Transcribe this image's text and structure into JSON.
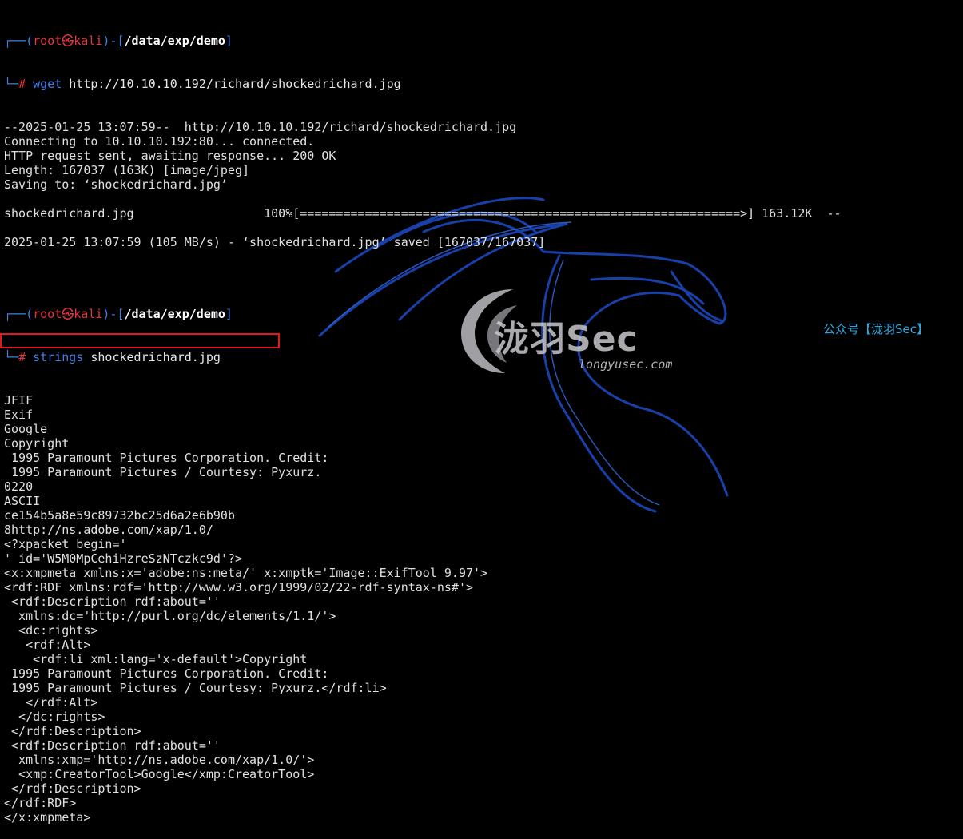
{
  "prompt1": {
    "open": "┌──(",
    "user": "root",
    "at": "㉿",
    "host": "kali",
    "mid": ")-[",
    "path": "/data/exp/demo",
    "close": "]",
    "corner": "└─",
    "hash": "#",
    "command": "wget",
    "args": "http://10.10.10.192/richard/shockedrichard.jpg"
  },
  "wget_output": [
    "--2025-01-25 13:07:59--  http://10.10.10.192/richard/shockedrichard.jpg",
    "Connecting to 10.10.10.192:80... connected.",
    "HTTP request sent, awaiting response... 200 OK",
    "Length: 167037 (163K) [image/jpeg]",
    "Saving to: ‘shockedrichard.jpg’",
    "",
    "shockedrichard.jpg                  100%[=============================================================>] 163.12K  --",
    "",
    "2025-01-25 13:07:59 (105 MB/s) - ‘shockedrichard.jpg’ saved [167037/167037]",
    "",
    ""
  ],
  "prompt2": {
    "open": "┌──(",
    "user": "root",
    "at": "㉿",
    "host": "kali",
    "mid": ")-[",
    "path": "/data/exp/demo",
    "close": "]",
    "corner": "└─",
    "hash": "#",
    "command": "strings",
    "args": "shockedrichard.jpg"
  },
  "strings_output": [
    "JFIF",
    "Exif",
    "Google",
    "Copyright",
    " 1995 Paramount Pictures Corporation. Credit:",
    " 1995 Paramount Pictures / Courtesy: Pyxurz.",
    "0220",
    "ASCII",
    "ce154b5a8e59c89732bc25d6a2e6b90b",
    "8http://ns.adobe.com/xap/1.0/",
    "<?xpacket begin='",
    "' id='W5M0MpCehiHzreSzNTczkc9d'?>",
    "<x:xmpmeta xmlns:x='adobe:ns:meta/' x:xmptk='Image::ExifTool 9.97'>",
    "<rdf:RDF xmlns:rdf='http://www.w3.org/1999/02/22-rdf-syntax-ns#'>",
    " <rdf:Description rdf:about=''",
    "  xmlns:dc='http://purl.org/dc/elements/1.1/'>",
    "  <dc:rights>",
    "   <rdf:Alt>",
    "    <rdf:li xml:lang='x-default'>Copyright",
    " 1995 Paramount Pictures Corporation. Credit:",
    " 1995 Paramount Pictures / Courtesy: Pyxurz.</rdf:li>",
    "   </rdf:Alt>",
    "  </dc:rights>",
    " </rdf:Description>",
    " <rdf:Description rdf:about=''",
    "  xmlns:xmp='http://ns.adobe.com/xap/1.0/'>",
    "  <xmp:CreatorTool>Google</xmp:CreatorTool>",
    " </rdf:Description>",
    "</rdf:RDF>",
    "</x:xmpmeta>"
  ],
  "highlighted_hash_index": 8,
  "watermark": {
    "name": "泷羽Sec",
    "site": "longyusec.com",
    "channel": "公众号【泷羽Sec】"
  },
  "colors": {
    "background": "#000000",
    "prompt_frame": "#3f7fe6",
    "prompt_user": "#e2373b",
    "text": "#e0e0e0",
    "highlight_box": "#e0191f",
    "channel_label": "#2aa8e0"
  },
  "icons": {
    "background": "kali-dragon-icon",
    "watermark": "longyu-logo-icon"
  }
}
